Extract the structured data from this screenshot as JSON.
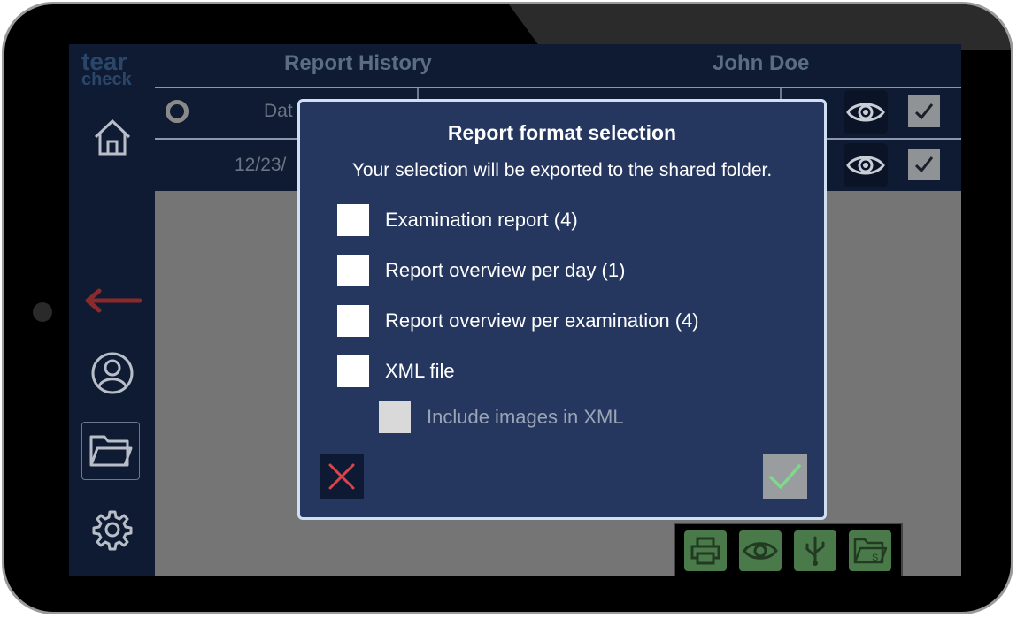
{
  "app": {
    "logo_line1": "tear",
    "logo_line2": "check"
  },
  "header": {
    "title": "Report History",
    "user": "John Doe"
  },
  "table": {
    "header_row": {
      "date_label": "Dat"
    },
    "rows": [
      {
        "date": "12/23/"
      }
    ]
  },
  "sidebar": {
    "items": [
      {
        "name": "home",
        "icon": "home-icon"
      },
      {
        "name": "back",
        "icon": "back-arrow-icon"
      },
      {
        "name": "patient",
        "icon": "user-icon"
      },
      {
        "name": "reports",
        "icon": "folder-icon"
      },
      {
        "name": "settings",
        "icon": "gear-icon"
      }
    ]
  },
  "actionbar": {
    "items": [
      "printer-icon",
      "eye-icon",
      "usb-icon",
      "shared-folder-icon"
    ]
  },
  "dialog": {
    "title": "Report format selection",
    "subtitle": "Your selection will be exported to the shared folder.",
    "options": [
      {
        "label": "Examination report (4)",
        "checked": false,
        "enabled": true
      },
      {
        "label": "Report overview per day (1)",
        "checked": false,
        "enabled": true
      },
      {
        "label": "Report overview per examination (4)",
        "checked": false,
        "enabled": true
      },
      {
        "label": "XML file",
        "checked": false,
        "enabled": true
      },
      {
        "label": "Include images in XML",
        "checked": false,
        "enabled": false
      }
    ]
  },
  "colors": {
    "dialog_bg": "#25375f",
    "cancel_x": "#d9434a",
    "confirm_check": "#7fd98a",
    "back_arrow": "#8c2a2a"
  }
}
